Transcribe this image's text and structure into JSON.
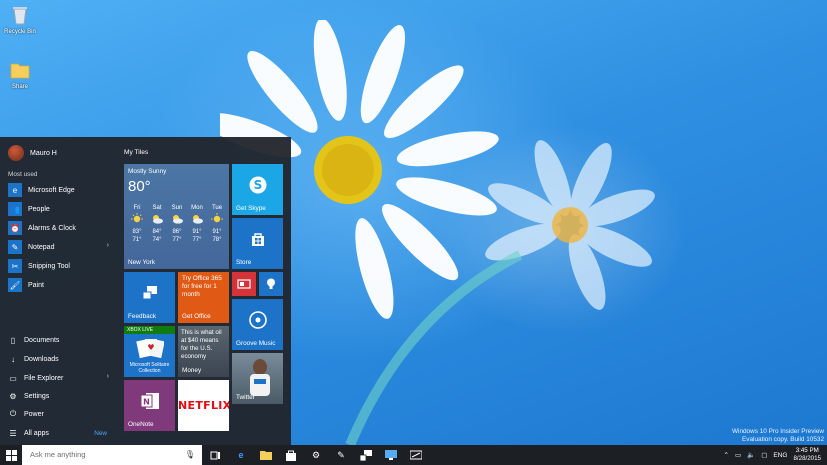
{
  "desktop": {
    "icons": [
      {
        "label": "Recycle Bin"
      },
      {
        "label": "Share"
      }
    ],
    "watermark": {
      "line1": "Windows 10 Pro Insider Preview",
      "line2": "Evaluation copy. Build 10532"
    }
  },
  "start_menu": {
    "user_name": "Mauro H",
    "most_used_label": "Most used",
    "apps": [
      {
        "label": "Microsoft Edge",
        "icon": "edge-icon",
        "color": "#1c73c8"
      },
      {
        "label": "People",
        "icon": "people-icon",
        "color": "#1c73c8"
      },
      {
        "label": "Alarms & Clock",
        "icon": "alarm-icon",
        "color": "#1c73c8"
      },
      {
        "label": "Notepad",
        "icon": "notepad-icon",
        "color": "#1c73c8"
      },
      {
        "label": "Snipping Tool",
        "icon": "scissors-icon",
        "color": "#1c73c8"
      },
      {
        "label": "Paint",
        "icon": "paint-icon",
        "color": "#1c73c8"
      }
    ],
    "places": [
      {
        "label": "Documents"
      },
      {
        "label": "Downloads"
      },
      {
        "label": "File Explorer"
      },
      {
        "label": "Settings"
      },
      {
        "label": "Power"
      },
      {
        "label": "All apps",
        "badge": "New"
      }
    ],
    "tiles_header": "My Tiles",
    "tiles": {
      "weather": {
        "condition": "Mostly Sunny",
        "temperature": "80°",
        "city": "New York",
        "forecast": [
          {
            "day": "Fri",
            "high": "83°",
            "low": "71°"
          },
          {
            "day": "Sat",
            "high": "84°",
            "low": "74°"
          },
          {
            "day": "Sun",
            "high": "86°",
            "low": "77°"
          },
          {
            "day": "Mon",
            "high": "91°",
            "low": "77°"
          },
          {
            "day": "Tue",
            "high": "91°",
            "low": "78°"
          }
        ]
      },
      "skype": "Get Skype",
      "store": "Store",
      "feedback": "Feedback",
      "office": {
        "text": "Try Office 365 for free for 1 month",
        "label": "Get Office"
      },
      "groove": "Groove Music",
      "solitaire": {
        "badge": "XBOX LIVE",
        "label": "Microsoft Solitaire Collection"
      },
      "money": {
        "text": "This is what oil at $40 means for the U.S. economy",
        "label": "Money"
      },
      "twitter": "Twitter",
      "onenote": "OneNote",
      "netflix": "NETFLIX"
    }
  },
  "taskbar": {
    "search_placeholder": "Ask me anything",
    "language": "ENG",
    "time": "3:45 PM",
    "date": "8/28/2015"
  },
  "colors": {
    "accent": "#1c73c8",
    "skype": "#1ba7e6",
    "office": "#e05a16",
    "onenote": "#80397b",
    "xbox": "#107c10",
    "netflix": "#e50914"
  }
}
